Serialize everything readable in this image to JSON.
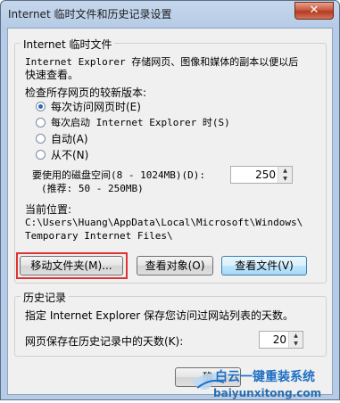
{
  "window": {
    "title": "Internet 临时文件和历史记录设置",
    "close_glyph": "✕"
  },
  "temp_files": {
    "group_label": "Internet 临时文件",
    "description_line1": "Internet Explorer 存储网页、图像和媒体的副本以便以后",
    "description_line2": "快速查看。",
    "check_label": "检查所存网页的较新版本:",
    "options": [
      {
        "label": "每次访问网页时(E)",
        "checked": true
      },
      {
        "label": "每次启动 Internet Explorer 时(S)",
        "checked": false
      },
      {
        "label": "自动(A)",
        "checked": false
      },
      {
        "label": "从不(N)",
        "checked": false
      }
    ],
    "disk_space_label": "要使用的磁盘空间(8 - 1024MB)(D):",
    "disk_space_hint": "(推荐: 50 - 250MB)",
    "disk_space_value": "250",
    "location_label": "当前位置:",
    "location_line1": "C:\\Users\\Huang\\AppData\\Local\\Microsoft\\Windows\\",
    "location_line2": "Temporary Internet Files\\",
    "buttons": {
      "move_folder": "移动文件夹(M)...",
      "view_objects": "查看对象(O)",
      "view_files": "查看文件(V)"
    }
  },
  "history": {
    "group_label": "历史记录",
    "description": "指定 Internet Explorer 保存您访问过网站列表的天数。",
    "days_label": "网页保存在历史记录中的天数(K):",
    "days_value": "20"
  },
  "bottom": {
    "ok_partial": "确"
  },
  "watermark": {
    "brand": "白云一键重装系统",
    "url": "baiyunxitong.com",
    "accent": "#1f6fc4"
  },
  "colors": {
    "highlight": "#e03232",
    "focus_border": "#3c7fb1"
  }
}
